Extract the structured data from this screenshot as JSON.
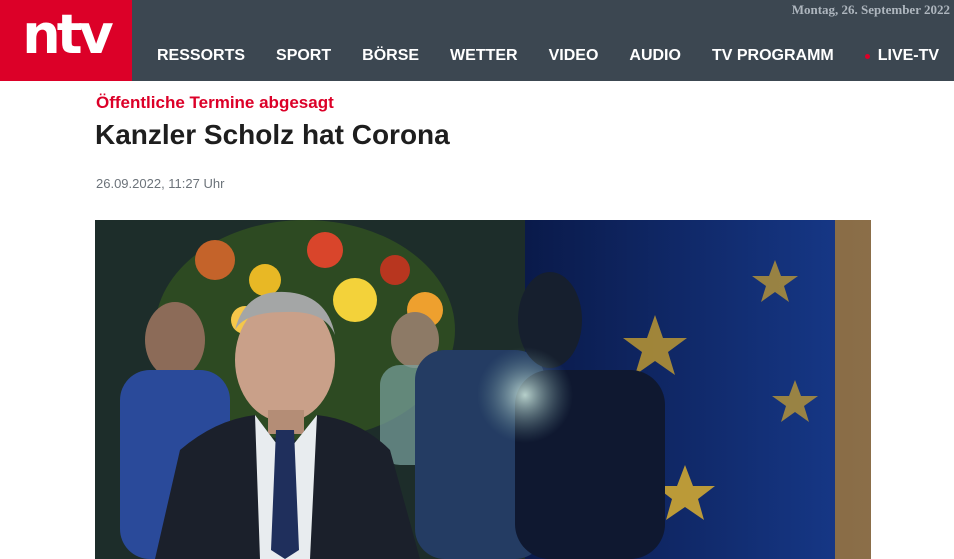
{
  "header": {
    "logo_text": "ntv",
    "date_text": "Montag, 26. September 2022",
    "nav": [
      {
        "label": "RESSORTS"
      },
      {
        "label": "SPORT"
      },
      {
        "label": "BÖRSE"
      },
      {
        "label": "WETTER"
      },
      {
        "label": "VIDEO"
      },
      {
        "label": "AUDIO"
      },
      {
        "label": "TV PROGRAMM"
      },
      {
        "label": "LIVE-TV"
      }
    ]
  },
  "article": {
    "kicker": "Öffentliche Termine abgesagt",
    "headline": "Kanzler Scholz hat Corona",
    "timestamp": "26.09.2022, 11:27 Uhr"
  },
  "colors": {
    "brand_red": "#dc0028",
    "nav_bg": "#3c4751",
    "headline": "#1e1e1e",
    "meta_gray": "#6c737a"
  },
  "icons": {
    "live_indicator": "red-dot-icon"
  }
}
